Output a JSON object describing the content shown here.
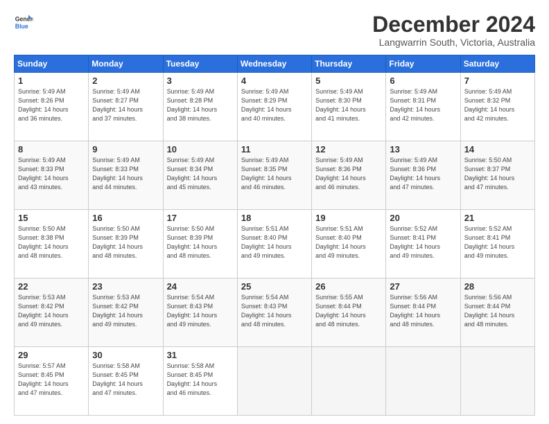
{
  "logo": {
    "line1": "General",
    "line2": "Blue"
  },
  "header": {
    "month": "December 2024",
    "location": "Langwarrin South, Victoria, Australia"
  },
  "weekdays": [
    "Sunday",
    "Monday",
    "Tuesday",
    "Wednesday",
    "Thursday",
    "Friday",
    "Saturday"
  ],
  "weeks": [
    [
      {
        "day": "1",
        "info": "Sunrise: 5:49 AM\nSunset: 8:26 PM\nDaylight: 14 hours\nand 36 minutes."
      },
      {
        "day": "2",
        "info": "Sunrise: 5:49 AM\nSunset: 8:27 PM\nDaylight: 14 hours\nand 37 minutes."
      },
      {
        "day": "3",
        "info": "Sunrise: 5:49 AM\nSunset: 8:28 PM\nDaylight: 14 hours\nand 38 minutes."
      },
      {
        "day": "4",
        "info": "Sunrise: 5:49 AM\nSunset: 8:29 PM\nDaylight: 14 hours\nand 40 minutes."
      },
      {
        "day": "5",
        "info": "Sunrise: 5:49 AM\nSunset: 8:30 PM\nDaylight: 14 hours\nand 41 minutes."
      },
      {
        "day": "6",
        "info": "Sunrise: 5:49 AM\nSunset: 8:31 PM\nDaylight: 14 hours\nand 42 minutes."
      },
      {
        "day": "7",
        "info": "Sunrise: 5:49 AM\nSunset: 8:32 PM\nDaylight: 14 hours\nand 42 minutes."
      }
    ],
    [
      {
        "day": "8",
        "info": "Sunrise: 5:49 AM\nSunset: 8:33 PM\nDaylight: 14 hours\nand 43 minutes."
      },
      {
        "day": "9",
        "info": "Sunrise: 5:49 AM\nSunset: 8:33 PM\nDaylight: 14 hours\nand 44 minutes."
      },
      {
        "day": "10",
        "info": "Sunrise: 5:49 AM\nSunset: 8:34 PM\nDaylight: 14 hours\nand 45 minutes."
      },
      {
        "day": "11",
        "info": "Sunrise: 5:49 AM\nSunset: 8:35 PM\nDaylight: 14 hours\nand 46 minutes."
      },
      {
        "day": "12",
        "info": "Sunrise: 5:49 AM\nSunset: 8:36 PM\nDaylight: 14 hours\nand 46 minutes."
      },
      {
        "day": "13",
        "info": "Sunrise: 5:49 AM\nSunset: 8:36 PM\nDaylight: 14 hours\nand 47 minutes."
      },
      {
        "day": "14",
        "info": "Sunrise: 5:50 AM\nSunset: 8:37 PM\nDaylight: 14 hours\nand 47 minutes."
      }
    ],
    [
      {
        "day": "15",
        "info": "Sunrise: 5:50 AM\nSunset: 8:38 PM\nDaylight: 14 hours\nand 48 minutes."
      },
      {
        "day": "16",
        "info": "Sunrise: 5:50 AM\nSunset: 8:39 PM\nDaylight: 14 hours\nand 48 minutes."
      },
      {
        "day": "17",
        "info": "Sunrise: 5:50 AM\nSunset: 8:39 PM\nDaylight: 14 hours\nand 48 minutes."
      },
      {
        "day": "18",
        "info": "Sunrise: 5:51 AM\nSunset: 8:40 PM\nDaylight: 14 hours\nand 49 minutes."
      },
      {
        "day": "19",
        "info": "Sunrise: 5:51 AM\nSunset: 8:40 PM\nDaylight: 14 hours\nand 49 minutes."
      },
      {
        "day": "20",
        "info": "Sunrise: 5:52 AM\nSunset: 8:41 PM\nDaylight: 14 hours\nand 49 minutes."
      },
      {
        "day": "21",
        "info": "Sunrise: 5:52 AM\nSunset: 8:41 PM\nDaylight: 14 hours\nand 49 minutes."
      }
    ],
    [
      {
        "day": "22",
        "info": "Sunrise: 5:53 AM\nSunset: 8:42 PM\nDaylight: 14 hours\nand 49 minutes."
      },
      {
        "day": "23",
        "info": "Sunrise: 5:53 AM\nSunset: 8:42 PM\nDaylight: 14 hours\nand 49 minutes."
      },
      {
        "day": "24",
        "info": "Sunrise: 5:54 AM\nSunset: 8:43 PM\nDaylight: 14 hours\nand 49 minutes."
      },
      {
        "day": "25",
        "info": "Sunrise: 5:54 AM\nSunset: 8:43 PM\nDaylight: 14 hours\nand 48 minutes."
      },
      {
        "day": "26",
        "info": "Sunrise: 5:55 AM\nSunset: 8:44 PM\nDaylight: 14 hours\nand 48 minutes."
      },
      {
        "day": "27",
        "info": "Sunrise: 5:56 AM\nSunset: 8:44 PM\nDaylight: 14 hours\nand 48 minutes."
      },
      {
        "day": "28",
        "info": "Sunrise: 5:56 AM\nSunset: 8:44 PM\nDaylight: 14 hours\nand 48 minutes."
      }
    ],
    [
      {
        "day": "29",
        "info": "Sunrise: 5:57 AM\nSunset: 8:45 PM\nDaylight: 14 hours\nand 47 minutes."
      },
      {
        "day": "30",
        "info": "Sunrise: 5:58 AM\nSunset: 8:45 PM\nDaylight: 14 hours\nand 47 minutes."
      },
      {
        "day": "31",
        "info": "Sunrise: 5:58 AM\nSunset: 8:45 PM\nDaylight: 14 hours\nand 46 minutes."
      },
      null,
      null,
      null,
      null
    ]
  ]
}
